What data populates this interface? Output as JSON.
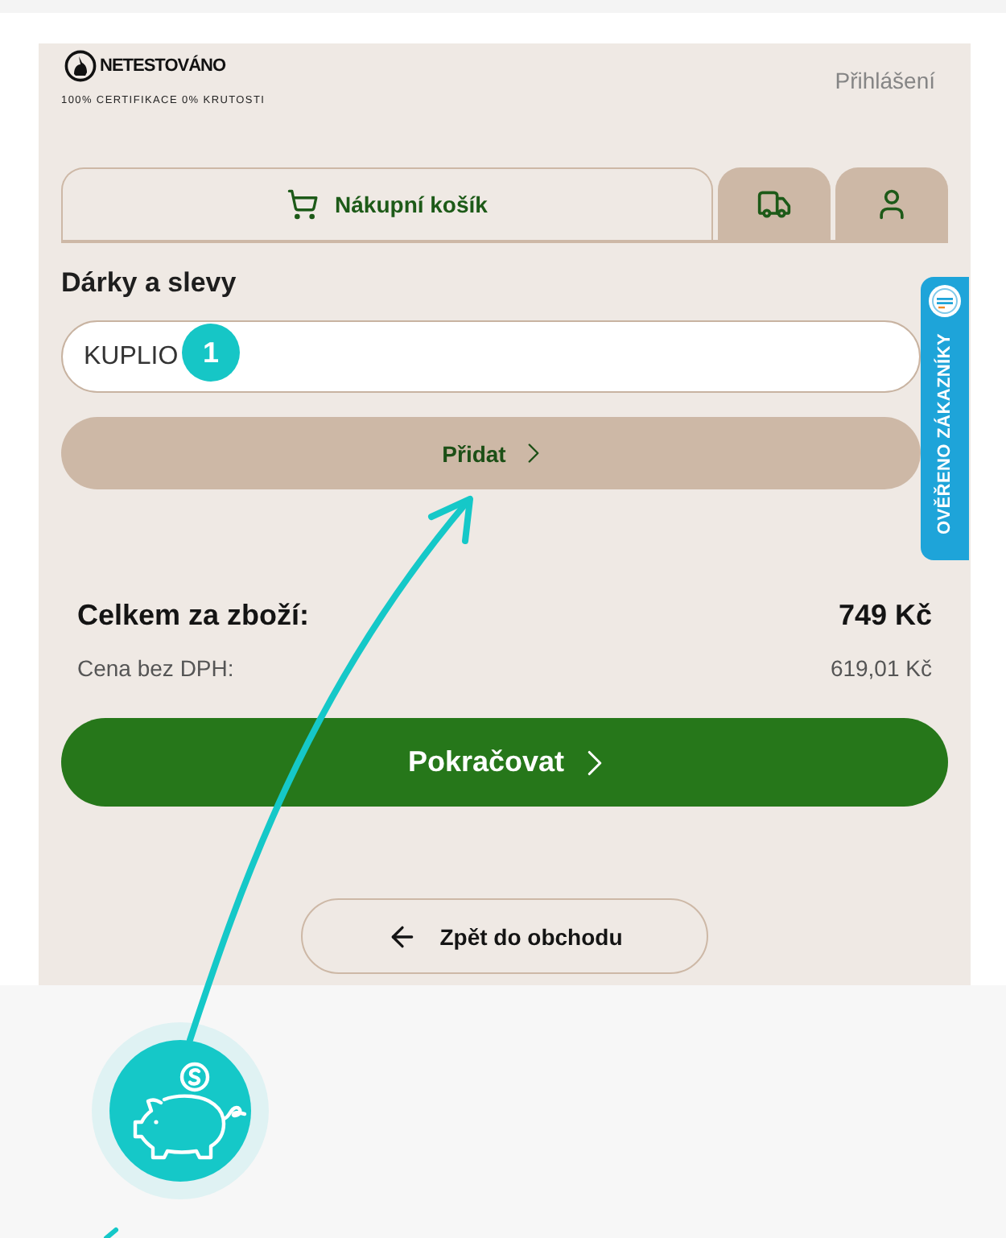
{
  "header": {
    "brand": "NETESTOVÁNO",
    "tagline": "100% CERTIFIKACE 0% KRUTOSTI",
    "login_link": "Přihlášení"
  },
  "tabs": [
    {
      "kind": "cart",
      "label": "Nákupní košík",
      "selected": true
    },
    {
      "kind": "delivery",
      "selected": false
    },
    {
      "kind": "account",
      "selected": false
    }
  ],
  "discount": {
    "heading": "Dárky a slevy",
    "code_field": {
      "value": "KUPLIO"
    },
    "add_button": "Přidat"
  },
  "annotation": {
    "step_badge": "1"
  },
  "totals": {
    "goods_label": "Celkem za zboží:",
    "goods_value": "749 Kč",
    "net_label": "Cena bez DPH:",
    "net_value": "619,01 Kč"
  },
  "continue_button": "Pokračovat",
  "back_button": "Zpět do obchodu",
  "side_badge": {
    "label": "OVĚŘENO ZÁKAZNÍKY"
  }
}
